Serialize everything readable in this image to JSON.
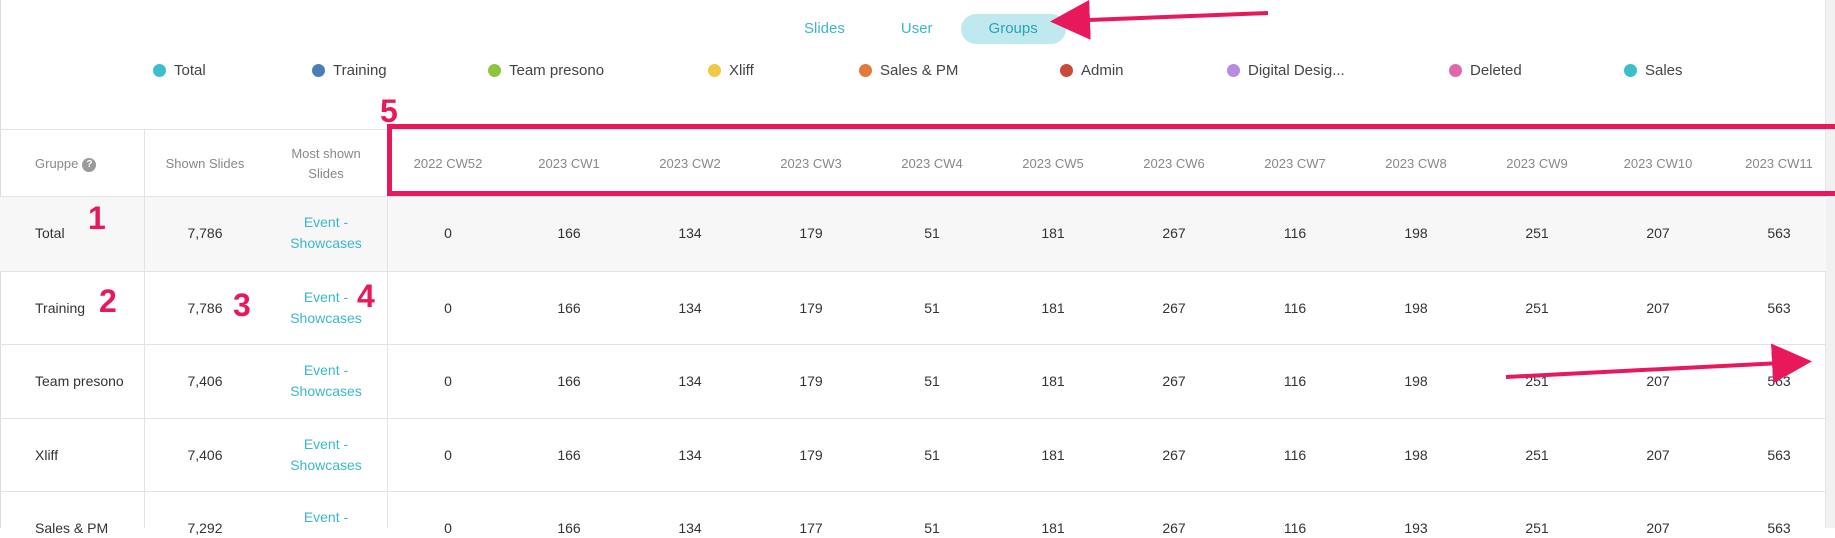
{
  "view_toggle": {
    "options": [
      "Slides",
      "User",
      "Groups"
    ],
    "active": "Groups"
  },
  "legend": [
    {
      "label": "Total",
      "color": "#3cbfc9"
    },
    {
      "label": "Training",
      "color": "#4a7fb5"
    },
    {
      "label": "Team presono",
      "color": "#8cc63f"
    },
    {
      "label": "Xliff",
      "color": "#f2c744"
    },
    {
      "label": "Sales & PM",
      "color": "#e07b39"
    },
    {
      "label": "Admin",
      "color": "#c94a3b"
    },
    {
      "label": "Digital Desig...",
      "color": "#b98be0"
    },
    {
      "label": "Deleted",
      "color": "#e068a8"
    },
    {
      "label": "Sales",
      "color": "#3cbfc9"
    }
  ],
  "table": {
    "headers": {
      "group": "Gruppe",
      "shown_slides": "Shown Slides",
      "most_shown_line1": "Most shown",
      "most_shown_line2": "Slides"
    },
    "weeks": [
      "2022 CW52",
      "2023 CW1",
      "2023 CW2",
      "2023 CW3",
      "2023 CW4",
      "2023 CW5",
      "2023 CW6",
      "2023 CW7",
      "2023 CW8",
      "2023 CW9",
      "2023 CW10",
      "2023 CW11"
    ],
    "rows": [
      {
        "group": "Total",
        "shown": "7,786",
        "most_line1": "Event -",
        "most_line2": "Showcases",
        "values": [
          "0",
          "166",
          "134",
          "179",
          "51",
          "181",
          "267",
          "116",
          "198",
          "251",
          "207",
          "563"
        ]
      },
      {
        "group": "Training",
        "shown": "7,786",
        "most_line1": "Event -",
        "most_line2": "Showcases",
        "values": [
          "0",
          "166",
          "134",
          "179",
          "51",
          "181",
          "267",
          "116",
          "198",
          "251",
          "207",
          "563"
        ]
      },
      {
        "group": "Team presono",
        "shown": "7,406",
        "most_line1": "Event -",
        "most_line2": "Showcases",
        "values": [
          "0",
          "166",
          "134",
          "179",
          "51",
          "181",
          "267",
          "116",
          "198",
          "251",
          "207",
          "563"
        ]
      },
      {
        "group": "Xliff",
        "shown": "7,406",
        "most_line1": "Event -",
        "most_line2": "Showcases",
        "values": [
          "0",
          "166",
          "134",
          "179",
          "51",
          "181",
          "267",
          "116",
          "198",
          "251",
          "207",
          "563"
        ]
      },
      {
        "group": "Sales & PM",
        "shown": "7,292",
        "most_line1": "Event -",
        "most_line2": "",
        "values": [
          "0",
          "166",
          "134",
          "177",
          "51",
          "181",
          "267",
          "116",
          "193",
          "251",
          "207",
          "563"
        ]
      }
    ]
  },
  "annotations": {
    "n1": "1",
    "n2": "2",
    "n3": "3",
    "n4": "4",
    "n5": "5",
    "color": "#e8195a"
  }
}
